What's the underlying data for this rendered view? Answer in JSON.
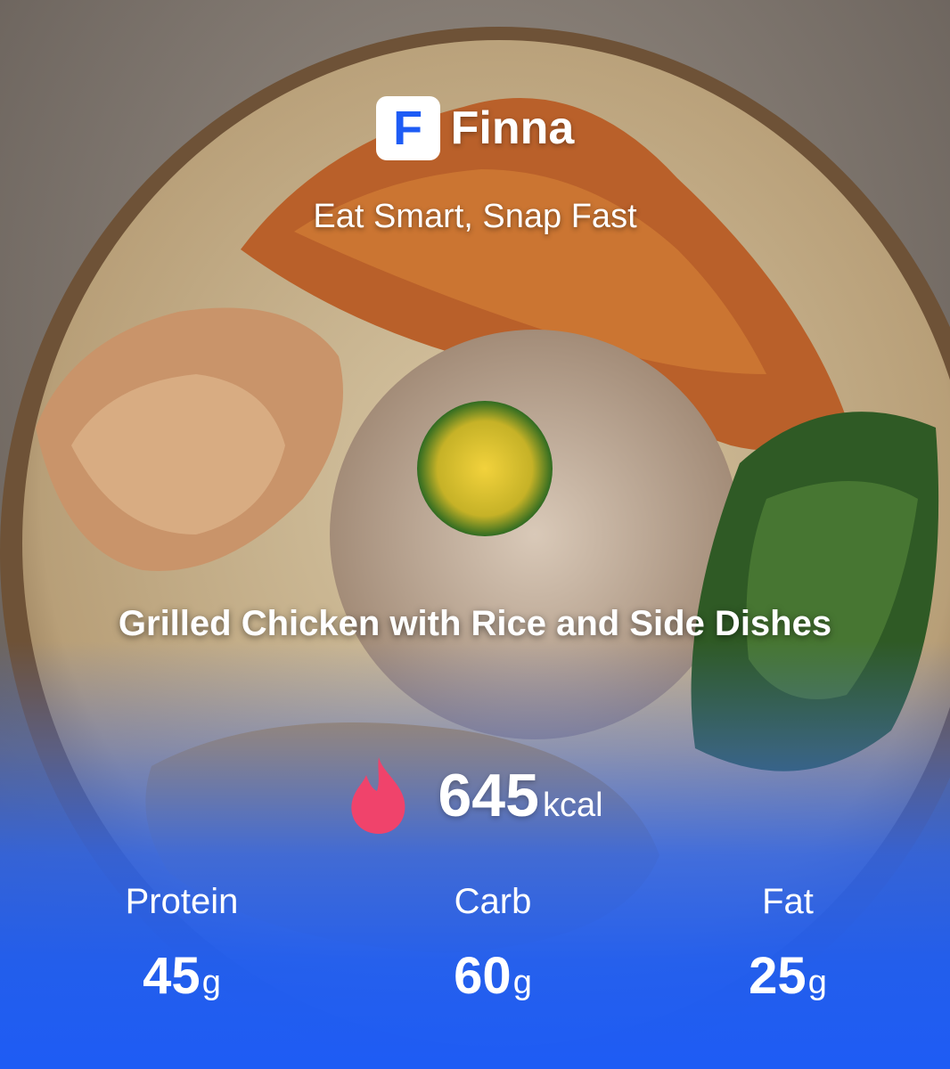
{
  "app": {
    "logo_letter": "F",
    "name": "Finna",
    "tagline": "Eat Smart, Snap Fast"
  },
  "dish": {
    "name": "Grilled Chicken with Rice and Side Dishes"
  },
  "nutrition": {
    "calories_value": "645",
    "calories_unit": "kcal",
    "macros": [
      {
        "label": "Protein",
        "value": "45",
        "unit": "g"
      },
      {
        "label": "Carb",
        "value": "60",
        "unit": "g"
      },
      {
        "label": "Fat",
        "value": "25",
        "unit": "g"
      }
    ]
  },
  "colors": {
    "brand_blue": "#1e5cf5",
    "flame_pink": "#f0436b",
    "text": "#ffffff"
  },
  "icons": {
    "logo": "f-letter-logo-icon",
    "calories": "flame-icon"
  }
}
